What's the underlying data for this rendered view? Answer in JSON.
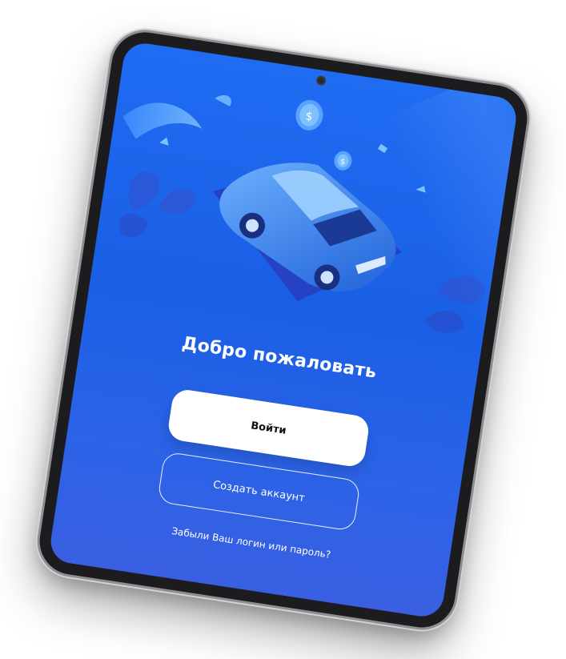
{
  "welcome": {
    "title": "Добро пожаловать"
  },
  "actions": {
    "login_label": "Войти",
    "register_label": "Создать аккаунт",
    "forgot_label": "Забыли Ваш логин или пароль?"
  },
  "illustration": {
    "coin_symbol": "$"
  },
  "colors": {
    "screen_background": "#1f6cf2",
    "primary_button": "#ffffff",
    "text_on_blue": "#ffffff"
  }
}
